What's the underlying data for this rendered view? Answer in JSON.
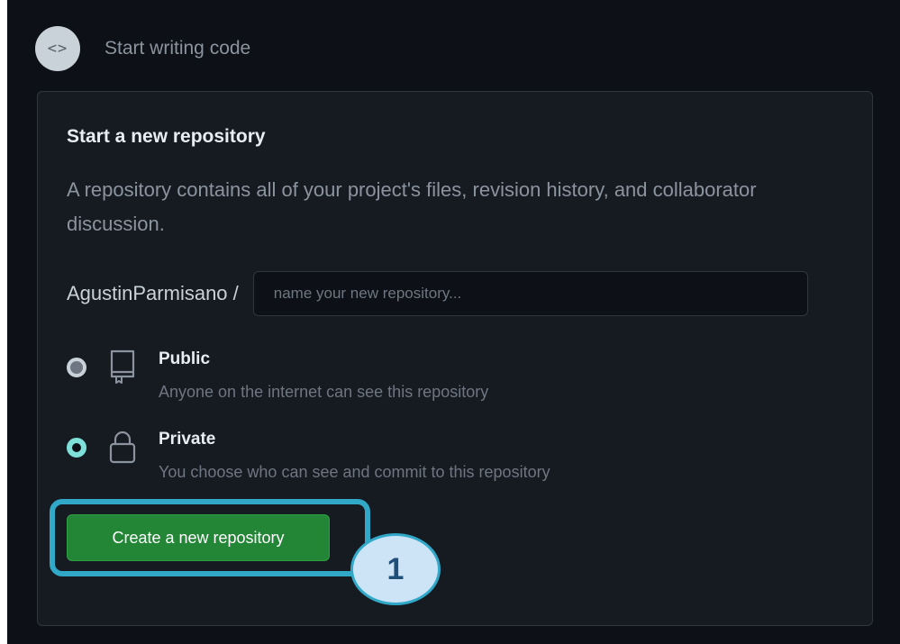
{
  "header": {
    "code_icon": "code-brackets-icon",
    "title": "Start writing code"
  },
  "card": {
    "title": "Start a new repository",
    "description": "A repository contains all of your project's files, revision history, and collaborator discussion.",
    "owner": "AgustinParmisano /",
    "name_input": {
      "value": "",
      "placeholder": "name your new repository..."
    },
    "visibility": {
      "selected": "Private",
      "options": [
        {
          "title": "Public",
          "description": "Anyone on the internet can see this repository",
          "icon": "repo-icon",
          "checked": false
        },
        {
          "title": "Private",
          "description": "You choose who can see and commit to this repository",
          "icon": "lock-icon",
          "checked": true
        }
      ]
    },
    "create_button_label": "Create a new repository"
  },
  "annotation": {
    "step_number": "1"
  },
  "colors": {
    "background": "#0d1117",
    "card": "#161b22",
    "button": "#238636",
    "highlight": "#31a8c8",
    "badge_fill": "#cde4f7"
  }
}
